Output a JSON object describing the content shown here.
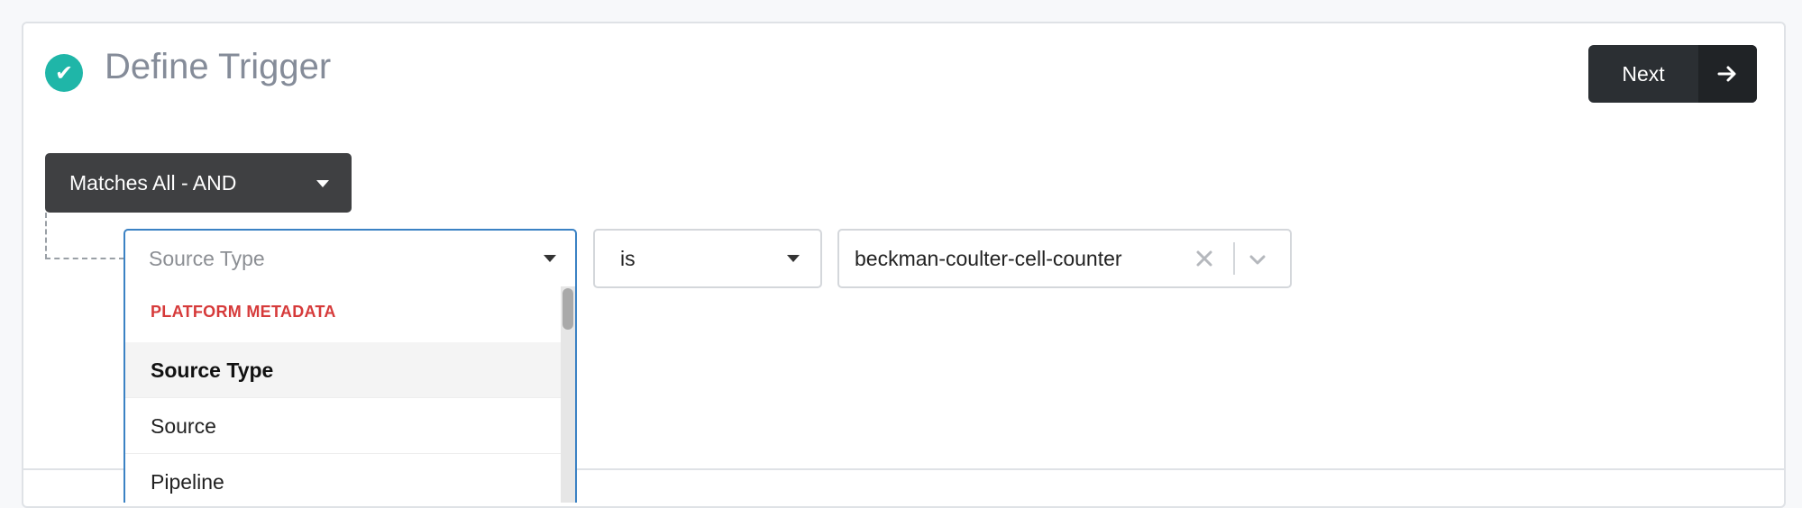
{
  "header": {
    "title": "Define Trigger",
    "status_icon": "check-circle-icon",
    "next_label": "Next",
    "next_icon": "arrow-right-icon"
  },
  "colors": {
    "accent": "#1fb6a8",
    "focus_border": "#3b82c4",
    "group_header": "#d63a3a",
    "dark_button": "#2b2f33"
  },
  "rule": {
    "match_mode": "Matches All - AND",
    "field": {
      "placeholder": "Source Type",
      "dropdown": {
        "group": "PLATFORM METADATA",
        "options": [
          "Source Type",
          "Source",
          "Pipeline"
        ],
        "highlighted": "Source Type"
      }
    },
    "operator": "is",
    "value": "beckman-coulter-cell-counter"
  }
}
